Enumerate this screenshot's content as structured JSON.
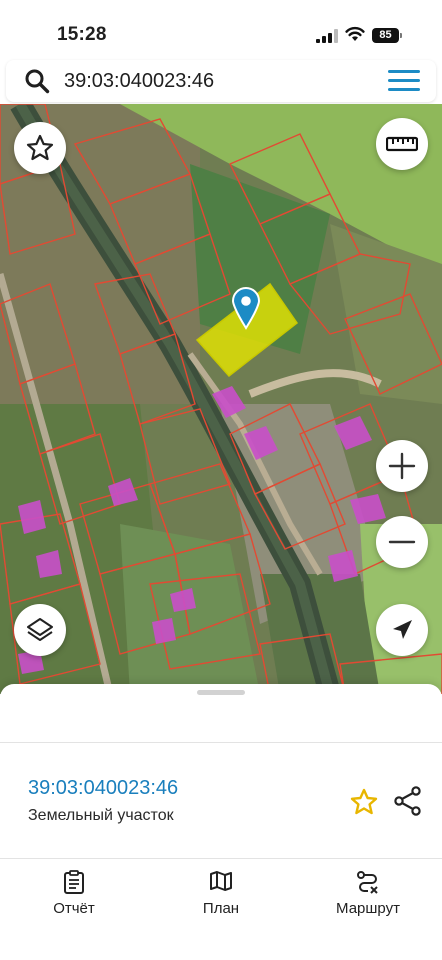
{
  "status_bar": {
    "time": "15:28",
    "battery": "85"
  },
  "search": {
    "value": "39:03:040023:46",
    "icon": "search-icon"
  },
  "menu": {
    "icon": "hamburger-menu-icon"
  },
  "map": {
    "selected_parcel_color": "#e6e600",
    "parcel_border_color": "#e24a33",
    "building_color": "#c94fc9",
    "marker_color": "#1c8bc5",
    "controls": [
      "star-icon",
      "ruler-icon",
      "zoom-in-icon",
      "zoom-out-icon",
      "layers-icon",
      "location-arrow-icon"
    ]
  },
  "sheet": {
    "parcel_id": "39:03:040023:46",
    "parcel_type": "Земельный участок",
    "star_color": "#e8b600",
    "tabs": [
      {
        "label": "Отчёт",
        "icon": "clipboard-icon"
      },
      {
        "label": "План",
        "icon": "map-icon"
      },
      {
        "label": "Маршрут",
        "icon": "route-icon"
      }
    ]
  }
}
